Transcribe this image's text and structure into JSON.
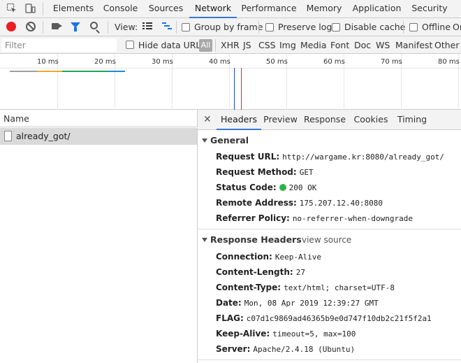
{
  "main_tabs": [
    "Elements",
    "Console",
    "Sources",
    "Network",
    "Performance",
    "Memory",
    "Application",
    "Security"
  ],
  "active_tab": "Network",
  "toolbar": {
    "view_label": "View:",
    "group_by_frame": "Group by frame",
    "preserve_log": "Preserve log",
    "disable_cache": "Disable cache",
    "offline": "Offline",
    "online_partial": "Or"
  },
  "filter": {
    "placeholder": "Filter",
    "hide_data_urls": "Hide data URLs",
    "all": "All",
    "types": [
      "XHR",
      "JS",
      "CSS",
      "Img",
      "Media",
      "Font",
      "Doc",
      "WS",
      "Manifest",
      "Other"
    ]
  },
  "overview": {
    "ticks": [
      "10 ms",
      "20 ms",
      "30 ms",
      "40 ms",
      "50 ms",
      "60 ms",
      "70 ms",
      "80 ms"
    ]
  },
  "request_list": {
    "header": "Name",
    "items": [
      "already_got/"
    ]
  },
  "detail_tabs": [
    "Headers",
    "Preview",
    "Response",
    "Cookies",
    "Timing"
  ],
  "active_detail_tab": "Headers",
  "general": {
    "title": "General",
    "rows": [
      {
        "key": "Request URL:",
        "value": "http://wargame.kr:8080/already_got/"
      },
      {
        "key": "Request Method:",
        "value": "GET"
      },
      {
        "key": "Status Code:",
        "value": "200 OK"
      },
      {
        "key": "Remote Address:",
        "value": "175.207.12.40:8080"
      },
      {
        "key": "Referrer Policy:",
        "value": "no-referrer-when-downgrade"
      }
    ]
  },
  "response_headers": {
    "title": "Response Headers",
    "view_source": "view source",
    "rows": [
      {
        "key": "Connection:",
        "value": "Keep-Alive"
      },
      {
        "key": "Content-Length:",
        "value": "27"
      },
      {
        "key": "Content-Type:",
        "value": "text/html; charset=UTF-8"
      },
      {
        "key": "Date:",
        "value": "Mon, 08 Apr 2019 12:39:27 GMT"
      },
      {
        "key": "FLAG:",
        "value": "c07d1c9869ad46365b9e0d747f10db2c21f5f2a1"
      },
      {
        "key": "Keep-Alive:",
        "value": "timeout=5, max=100"
      },
      {
        "key": "Server:",
        "value": "Apache/2.4.18 (Ubuntu)"
      }
    ]
  },
  "colors": {
    "accent": "#3879d9",
    "record": "#ea1f24",
    "status_ok": "#2db34a"
  }
}
